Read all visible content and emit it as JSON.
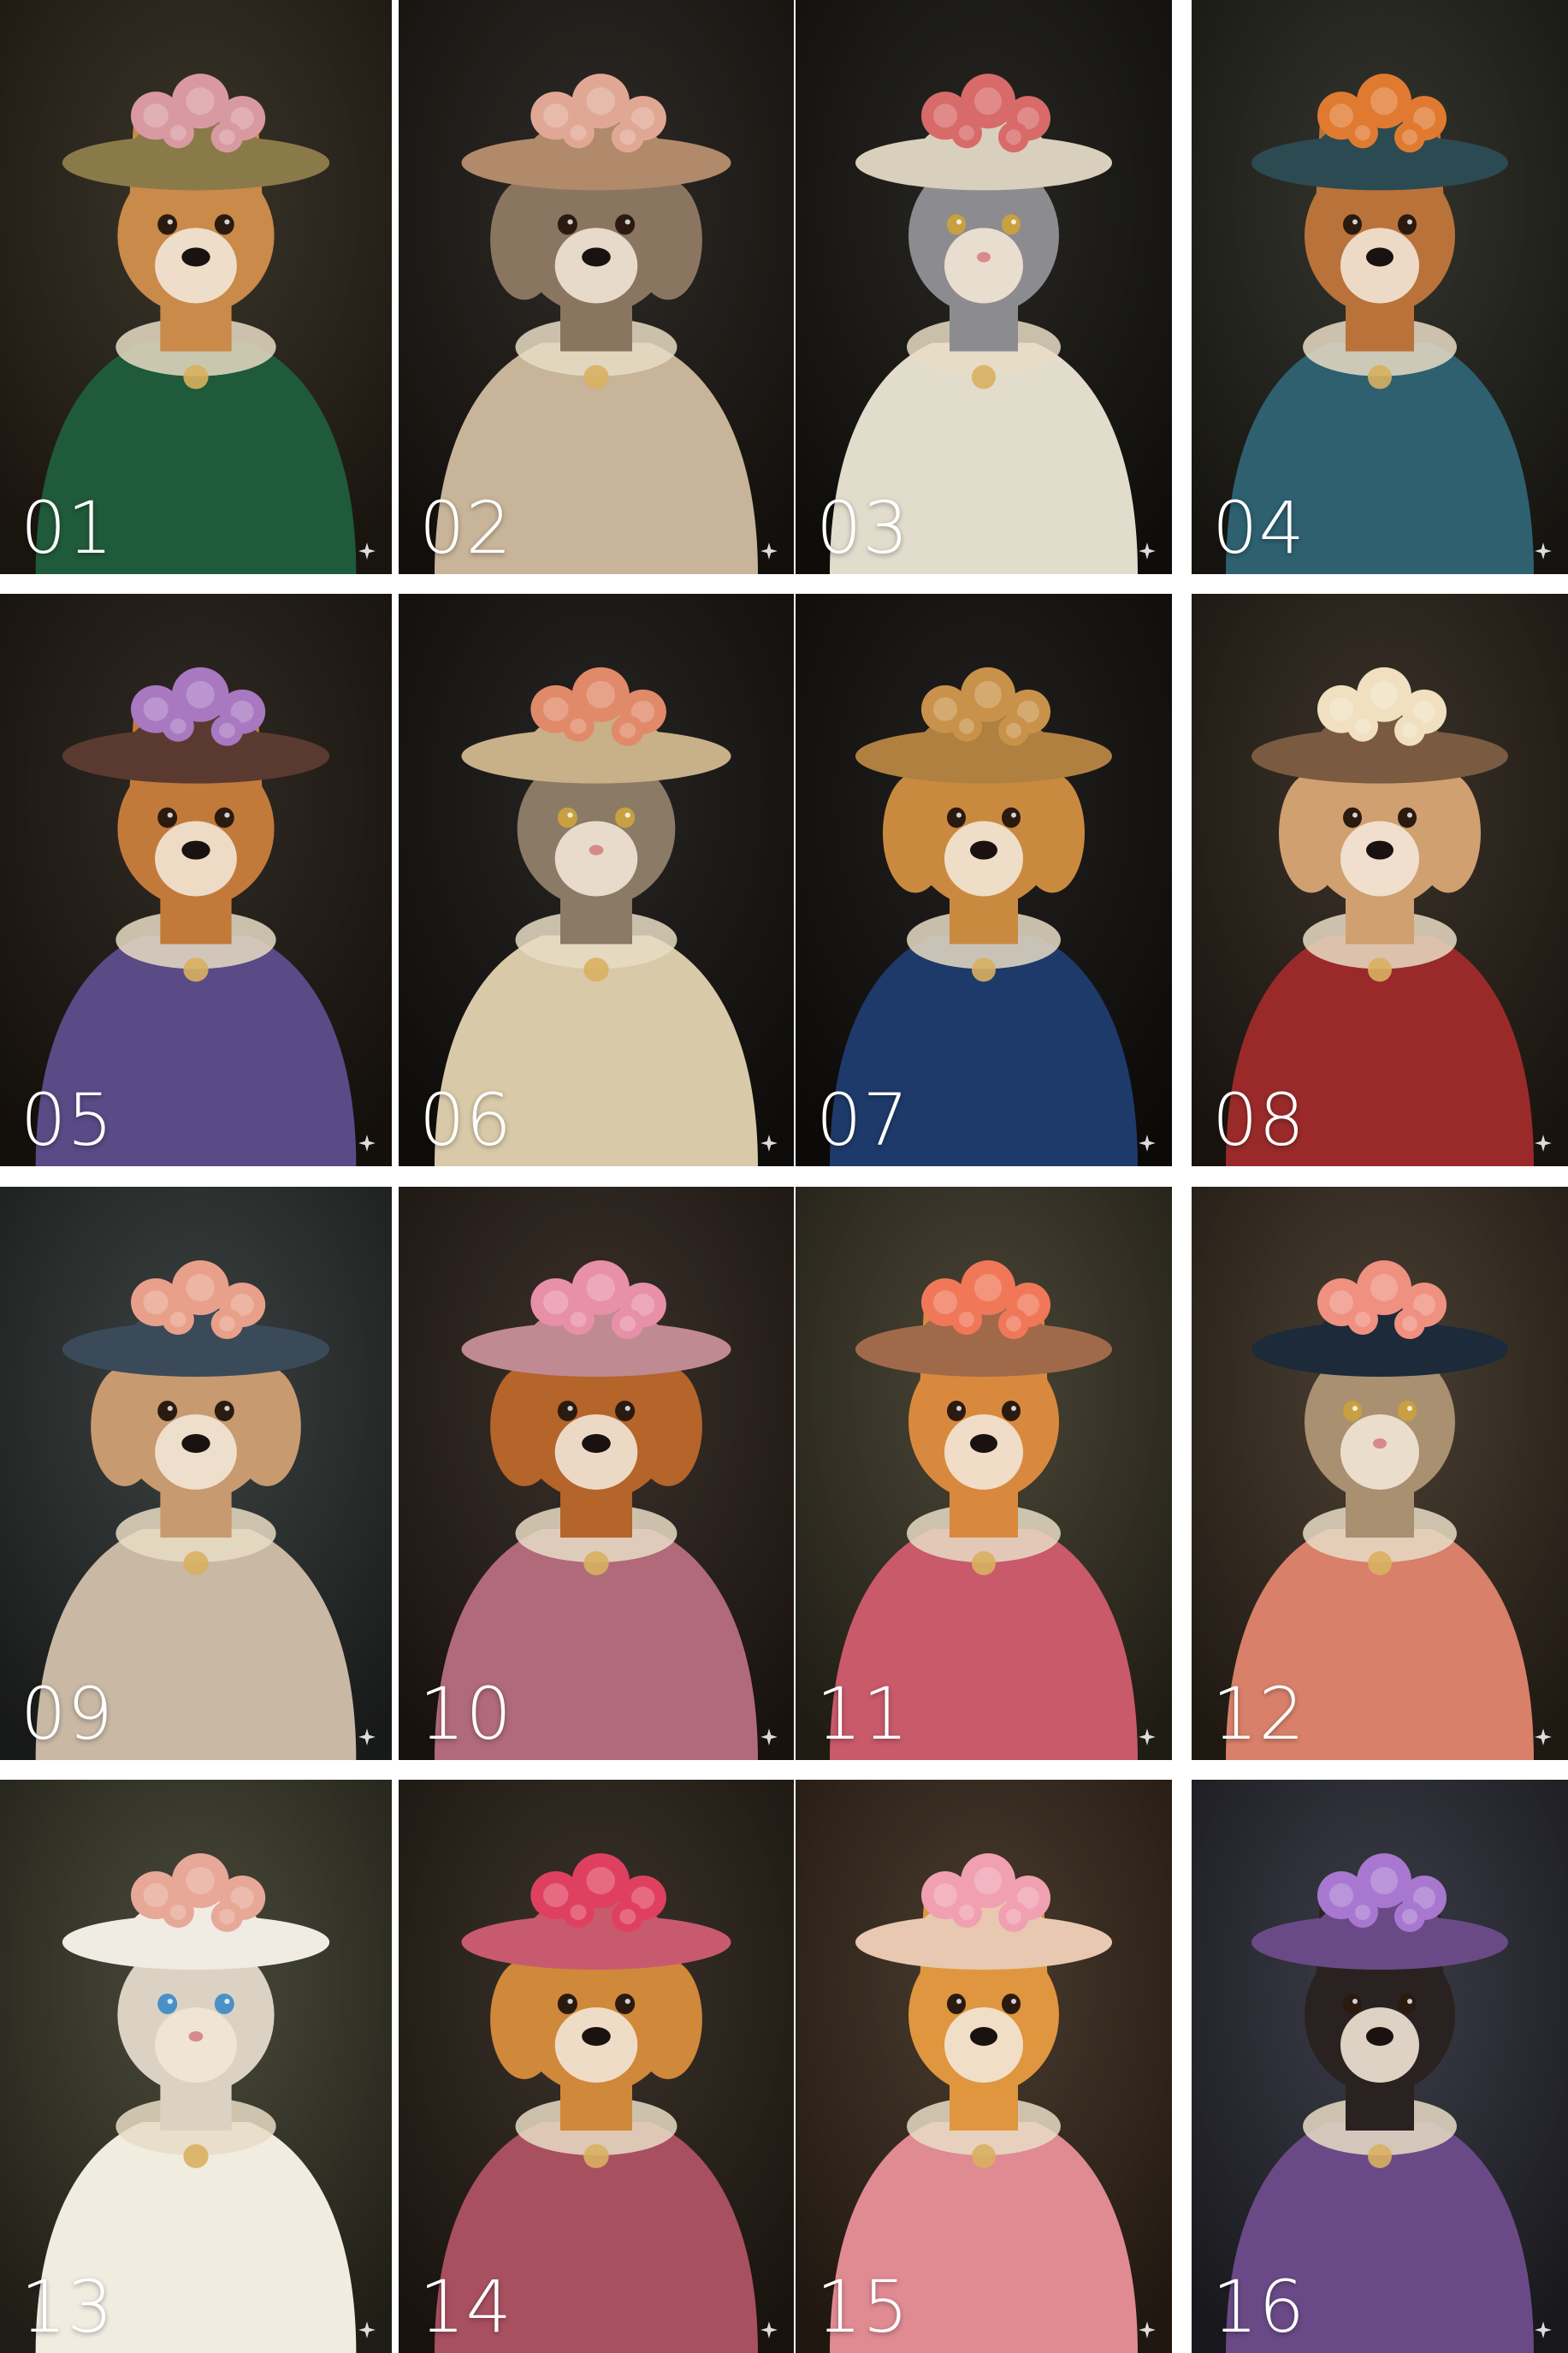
{
  "portraits": [
    {
      "label": "01",
      "animal": "corgi",
      "bg": "#2a2418",
      "fur": "#c98a4a",
      "outfit": "#1f5a3a",
      "hat": "#8a7a4a",
      "flower": "#d89aa0"
    },
    {
      "label": "02",
      "animal": "french-bulldog",
      "bg": "#1c1815",
      "fur": "#8a7560",
      "outfit": "#c8b498",
      "hat": "#b08a6a",
      "flower": "#e0a894"
    },
    {
      "label": "03",
      "animal": "grey-cat",
      "bg": "#15130f",
      "fur": "#8c8c90",
      "outfit": "#e2dccd",
      "hat": "#d8d0bc",
      "flower": "#d86a6a"
    },
    {
      "label": "04",
      "animal": "corgi",
      "bg": "#23241c",
      "fur": "#b9733a",
      "outfit": "#2e6070",
      "hat": "#2c4a52",
      "flower": "#e07a30"
    },
    {
      "label": "05",
      "animal": "corgi",
      "bg": "#1f1812",
      "fur": "#c27a3a",
      "outfit": "#5a4a86",
      "hat": "#5a3a30",
      "flower": "#a878c0"
    },
    {
      "label": "06",
      "animal": "tabby-cat",
      "bg": "#141210",
      "fur": "#8a7a66",
      "outfit": "#d8c9a8",
      "hat": "#c8b088",
      "flower": "#e08a6a"
    },
    {
      "label": "07",
      "animal": "shih-tzu",
      "bg": "#0f0d0b",
      "fur": "#c98a40",
      "outfit": "#1e3a6a",
      "hat": "#b08040",
      "flower": "#c8924a"
    },
    {
      "label": "08",
      "animal": "shih-tzu",
      "bg": "#2a2218",
      "fur": "#d0a070",
      "outfit": "#9a2a2a",
      "hat": "#7a5a40",
      "flower": "#f0e0c0"
    },
    {
      "label": "09",
      "animal": "shih-tzu",
      "bg": "#2a3030",
      "fur": "#c89a70",
      "outfit": "#c8b8a4",
      "hat": "#3a4a58",
      "flower": "#e8a08a"
    },
    {
      "label": "10",
      "animal": "dog",
      "bg": "#2a2018",
      "fur": "#b5642a",
      "outfit": "#b06a7a",
      "hat": "#c08a92",
      "flower": "#e890a8"
    },
    {
      "label": "11",
      "animal": "corgi",
      "bg": "#3a3526",
      "fur": "#d9893e",
      "outfit": "#c85a6a",
      "hat": "#a06a4a",
      "flower": "#f07858"
    },
    {
      "label": "12",
      "animal": "tabby-cat",
      "bg": "#3a2e22",
      "fur": "#a89070",
      "outfit": "#d8806a",
      "hat": "#1c2a3a",
      "flower": "#f09080"
    },
    {
      "label": "13",
      "animal": "ragdoll-cat",
      "bg": "#3a3a2a",
      "fur": "#dcd2c4",
      "outfit": "#f0ece0",
      "hat": "#f0ece4",
      "flower": "#e8a898"
    },
    {
      "label": "14",
      "animal": "golden-retriever",
      "bg": "#2a2218",
      "fur": "#d0883a",
      "outfit": "#a85060",
      "hat": "#c85a70",
      "flower": "#e04060"
    },
    {
      "label": "15",
      "animal": "corgi",
      "bg": "#3a2a1c",
      "fur": "#e0963e",
      "outfit": "#e08a92",
      "hat": "#e8c8b0",
      "flower": "#f0a0b0"
    },
    {
      "label": "16",
      "animal": "jack-russell",
      "bg": "#2a2c38",
      "fur": "#2a2220",
      "outfit": "#6a4a86",
      "hat": "#6a4a86",
      "flower": "#a878d0"
    }
  ]
}
